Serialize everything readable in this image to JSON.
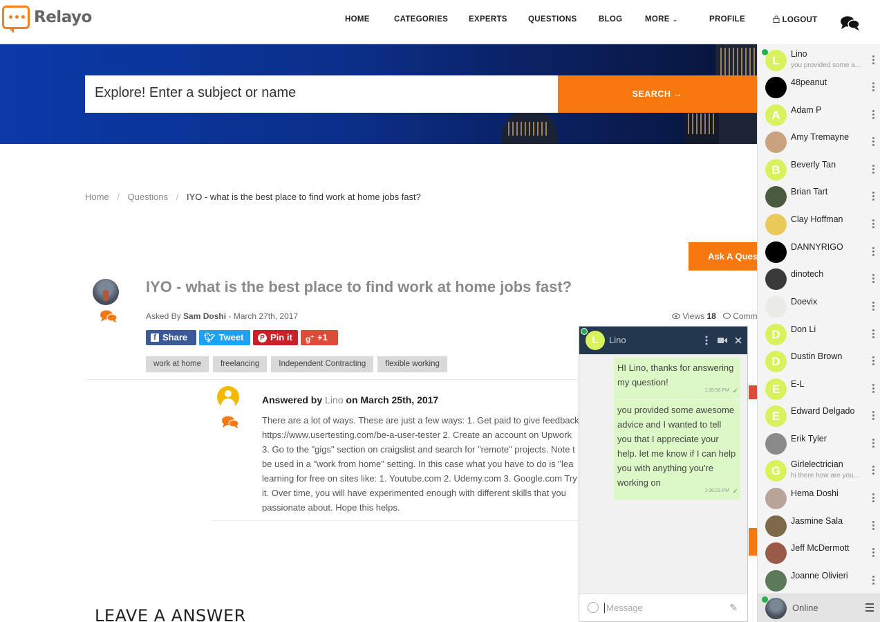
{
  "header": {
    "logo_text": "Relayo",
    "nav": [
      "HOME",
      "CATEGORIES",
      "EXPERTS",
      "QUESTIONS",
      "BLOG",
      "MORE",
      "PROFILE",
      "LOGOUT"
    ],
    "more_caret": "⌄",
    "logout_icon": "lock-icon"
  },
  "hero": {
    "search_placeholder": "Explore! Enter a subject or name",
    "search_button": "SEARCH →"
  },
  "breadcrumb": {
    "home": "Home",
    "sep": "/",
    "questions": "Questions",
    "current": "IYO - what is the best place to find work at home jobs fast?"
  },
  "ask_button": "Ask A Ques",
  "question": {
    "title": "IYO - what is the best place to find work at home jobs fast?",
    "asked_by_prefix": "Asked By",
    "author": "Sam Doshi",
    "date": "- March 27th, 2017",
    "views_label": "Views",
    "views_count": "18",
    "comments_label": "Comm",
    "share": {
      "facebook": "Share",
      "twitter": "Tweet",
      "pinterest": "Pin it",
      "gplus": "+1"
    },
    "tags": [
      "work at home",
      "freelancing",
      "Independent Contracting",
      "flexible working"
    ]
  },
  "answer": {
    "prefix": "Answered by",
    "author": "Lino",
    "date": "on March 25th, 2017",
    "lines": [
      "There are a lot of ways. These are just a few ways: 1. Get paid to give feedback",
      "https://www.usertesting.com/be-a-user-tester 2. Create an account on Upwork",
      "3. Go to the \"gigs\" section on craigslist and search for \"remote\" projects. Note t",
      "be used in a \"work from home\" setting. In this case what you have to do is \"lea",
      "learning for free on sites like: 1. Youtube.com 2. Udemy.com 3. Google.com Try",
      "it. Over time, you will have experimented enough with different skills that you",
      "passionate about. Hope this helps."
    ]
  },
  "leave_answer": "LEAVE A ANSWER",
  "chat": {
    "name": "Lino",
    "initial": "L",
    "messages": [
      {
        "text": "HI Lino, thanks for answering my question!",
        "time": "1:35:56 PM"
      },
      {
        "text": "you provided some awesome advice and I wanted to tell you that I appreciate your help. let me know if I can help you with anything you're working on",
        "time": "1:36:23 PM"
      }
    ],
    "input_placeholder": "Message"
  },
  "sidebar": {
    "contacts": [
      {
        "name": "Lino",
        "sub": "you provided some a...",
        "initial": "L",
        "color": "#d7f25d",
        "online": true
      },
      {
        "name": "48peanut",
        "initial": "",
        "color": "#000000"
      },
      {
        "name": "Adam P",
        "initial": "A",
        "color": "#d7f25d"
      },
      {
        "name": "Amy Tremayne",
        "initial": "",
        "color": "#c9a27e"
      },
      {
        "name": "Beverly Tan",
        "initial": "B",
        "color": "#d7f25d"
      },
      {
        "name": "Brian Tart",
        "initial": "",
        "color": "#4a5a3e"
      },
      {
        "name": "Clay Hoffman",
        "initial": "",
        "color": "#e8c95a"
      },
      {
        "name": "DANNYRIGO",
        "initial": "",
        "color": "#000000"
      },
      {
        "name": "dinotech",
        "initial": "",
        "color": "#3a3a3a"
      },
      {
        "name": "Doevix",
        "initial": "",
        "color": "#e9ebe4"
      },
      {
        "name": "Don Li",
        "initial": "D",
        "color": "#d7f25d"
      },
      {
        "name": "Dustin Brown",
        "initial": "D",
        "color": "#d7f25d"
      },
      {
        "name": "E-L",
        "initial": "E",
        "color": "#d7f25d"
      },
      {
        "name": "Edward Delgado",
        "initial": "E",
        "color": "#d7f25d"
      },
      {
        "name": "Erik Tyler",
        "initial": "",
        "color": "#8a8a8a"
      },
      {
        "name": "Girlelectrician",
        "sub": "hi there how are you...",
        "initial": "G",
        "color": "#d7f25d"
      },
      {
        "name": "Hema Doshi",
        "initial": "",
        "color": "#b9a49a"
      },
      {
        "name": "Jasmine Sala",
        "initial": "",
        "color": "#7c6a4a"
      },
      {
        "name": "Jeff McDermott",
        "initial": "",
        "color": "#9a5a4a"
      },
      {
        "name": "Joanne Olivieri",
        "initial": "",
        "color": "#5a7a5a"
      }
    ],
    "status": "Online"
  }
}
